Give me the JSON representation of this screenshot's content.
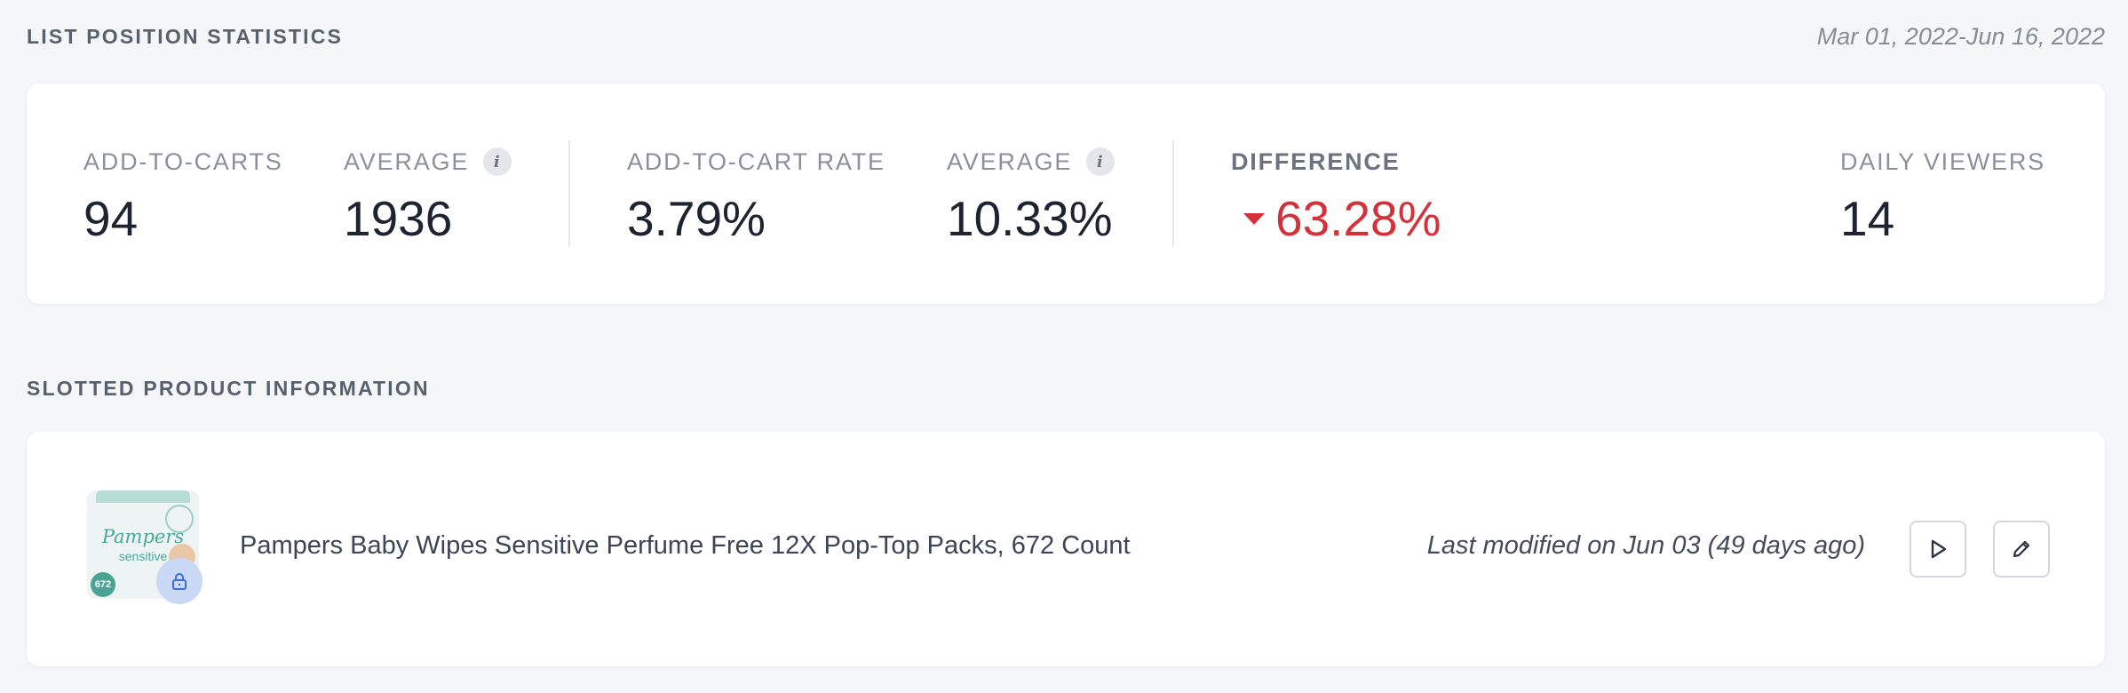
{
  "stats_section": {
    "title": "LIST POSITION STATISTICS",
    "date_range": "Mar 01, 2022-Jun 16, 2022",
    "add_to_carts": {
      "label": "ADD-TO-CARTS",
      "value": "94"
    },
    "add_to_carts_average": {
      "label": "AVERAGE",
      "value": "1936",
      "info_icon": "info-icon"
    },
    "add_to_cart_rate": {
      "label": "ADD-TO-CART RATE",
      "value": "3.79%"
    },
    "rate_average": {
      "label": "AVERAGE",
      "value": "10.33%",
      "info_icon": "info-icon"
    },
    "difference": {
      "label": "DIFFERENCE",
      "value": "63.28%",
      "direction": "down",
      "color": "#d4313b"
    },
    "daily_viewers": {
      "label": "DAILY VIEWERS",
      "value": "14"
    }
  },
  "product_section": {
    "title": "SLOTTED PRODUCT INFORMATION",
    "product": {
      "name": "Pampers Baby Wipes Sensitive Perfume Free 12X Pop-Top Packs, 672 Count",
      "last_modified": "Last modified on Jun 03 (49 days ago)",
      "thumbnail": {
        "brand": "Pampers",
        "variant": "sensitive",
        "count_badge": "672",
        "lock_icon": "lock-icon"
      },
      "actions": [
        {
          "name": "play",
          "icon": "play-icon"
        },
        {
          "name": "edit",
          "icon": "pencil-icon"
        }
      ]
    }
  }
}
